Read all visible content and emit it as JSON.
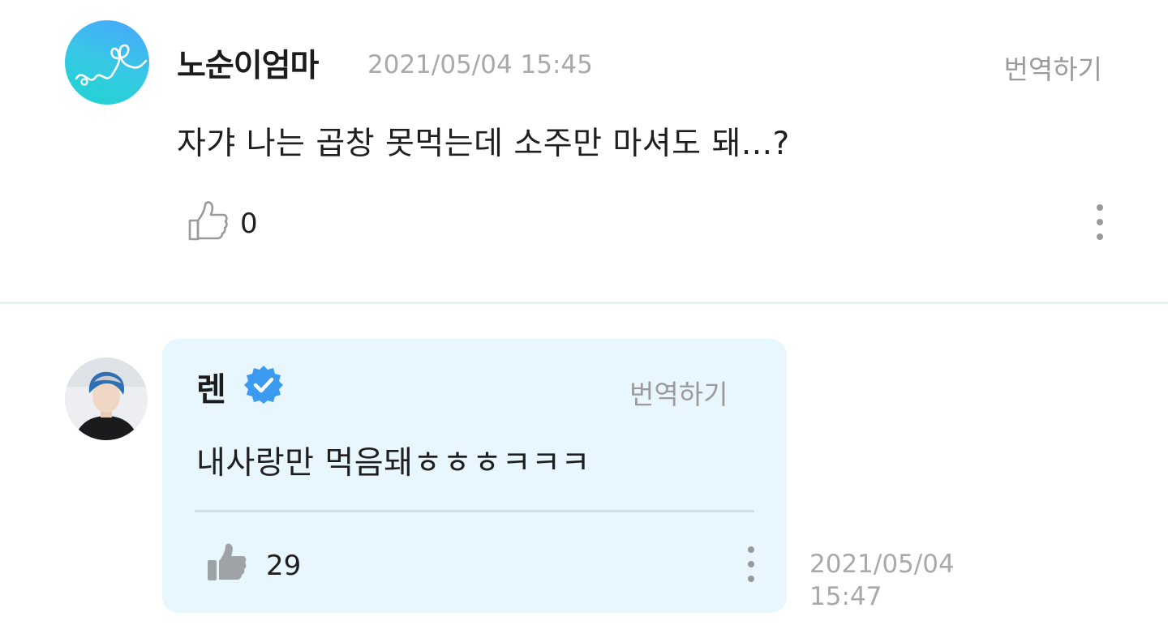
{
  "comment": {
    "author": "노순이엄마",
    "date": "2021/05/04 15:45",
    "translate_label": "번역하기",
    "text": "자갸 나는 곱창 못먹는데 소주만 마셔도 돼...?",
    "like_count": "0",
    "icons": {
      "like": "thumbs-up-outline-icon",
      "more": "more-vertical-icon"
    },
    "colors": {
      "avatar_gradient_start": "#4aa3ff",
      "avatar_gradient_end": "#1fd4cf"
    }
  },
  "reply": {
    "author": "렌",
    "verified": true,
    "translate_label": "번역하기",
    "text": "내사랑만 먹음돼ㅎㅎㅎㅋㅋㅋ",
    "like_count": "29",
    "date_line1": "2021/05/04",
    "date_line2": "15:47",
    "icons": {
      "verified": "verified-badge-icon",
      "like": "thumbs-up-filled-icon",
      "more": "more-vertical-icon"
    },
    "colors": {
      "background": "#e8f6fd",
      "verified": "#3b9bf0"
    }
  }
}
